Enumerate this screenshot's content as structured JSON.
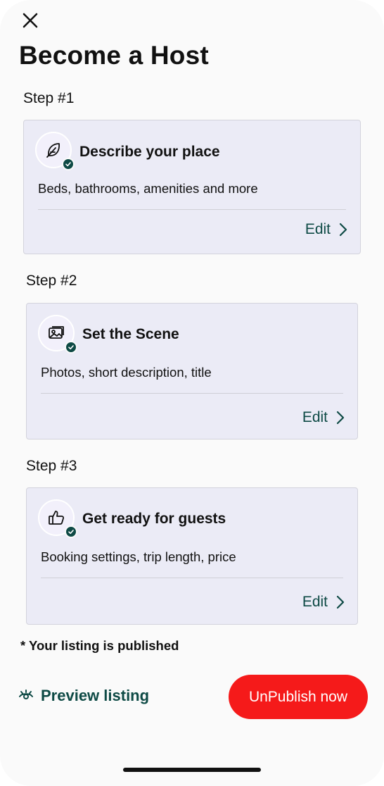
{
  "header": {
    "title": "Become a Host",
    "close_icon": "close-icon"
  },
  "steps": [
    {
      "label": "Step #1",
      "title": "Describe your place",
      "subtitle": "Beds, bathrooms, amenities and more",
      "edit_label": "Edit",
      "icon": "feather-icon",
      "completed": true
    },
    {
      "label": "Step #2",
      "title": "Set the Scene",
      "subtitle": "Photos, short description, title",
      "edit_label": "Edit",
      "icon": "photos-icon",
      "completed": true
    },
    {
      "label": "Step #3",
      "title": "Get ready for guests",
      "subtitle": "Booking settings, trip length, price",
      "edit_label": "Edit",
      "icon": "thumbs-up-icon",
      "completed": true
    }
  ],
  "footer": {
    "published_note": "* Your listing is published",
    "preview_label": "Preview listing",
    "preview_icon": "eye-icon",
    "unpublish_label": "UnPublish now"
  },
  "colors": {
    "accent": "#0e4a45",
    "danger": "#f51a1a",
    "card_bg": "#ebebf6"
  }
}
